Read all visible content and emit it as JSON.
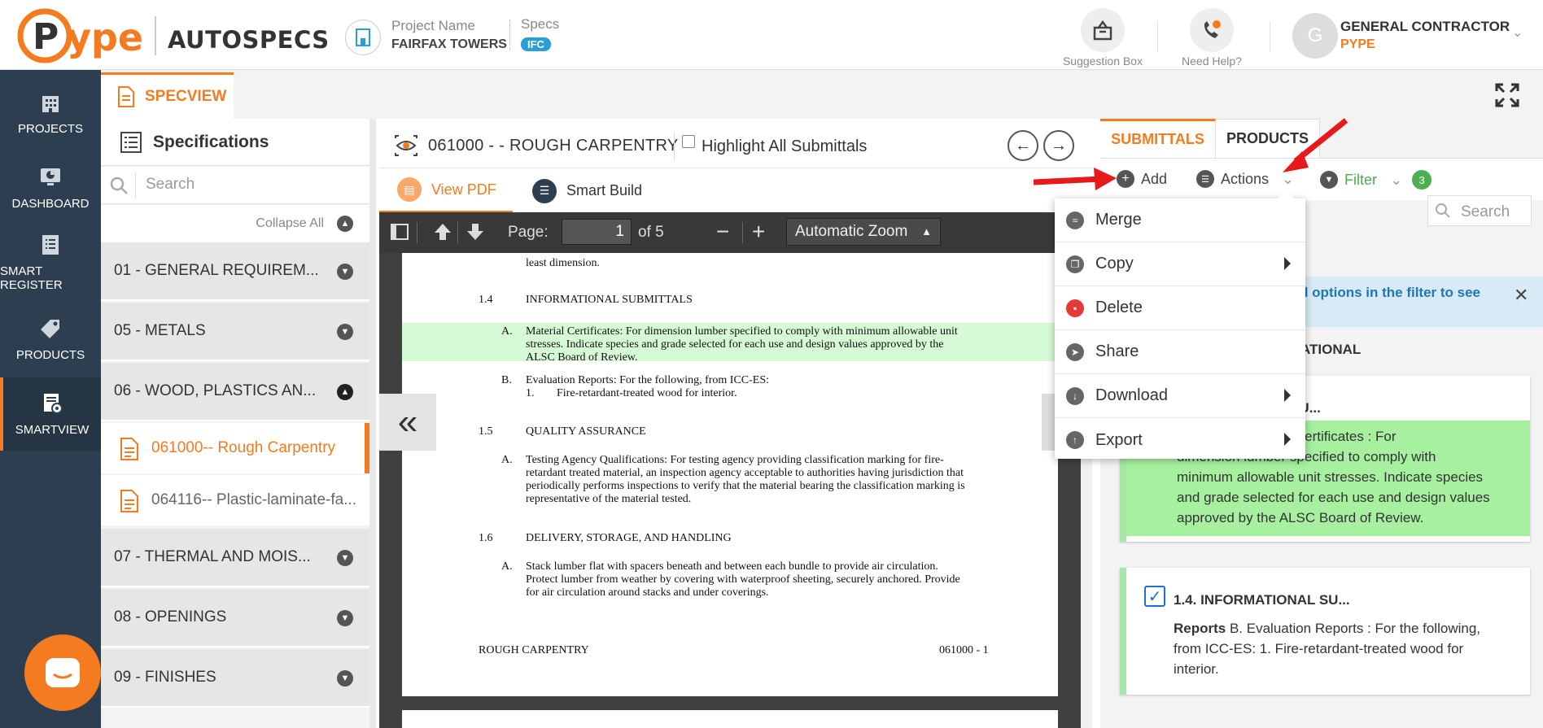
{
  "app": {
    "logo_text": "Pype",
    "product": "AUTOSPECS",
    "accent_color": "#f47b20",
    "nav_bg": "#2d3e50"
  },
  "header": {
    "project_label": "Project Name",
    "project_value": "FAIRFAX TOWERS",
    "specs_label": "Specs",
    "specs_badge": "IFC",
    "suggestion_label": "Suggestion Box",
    "help_label": "Need Help?",
    "avatar_initial": "G",
    "user_name": "GENERAL CONTRACTOR",
    "user_company": "PYPE"
  },
  "nav": {
    "items": [
      {
        "label": "PROJECTS",
        "icon": "building-icon"
      },
      {
        "label": "DASHBOARD",
        "icon": "monitor-chart-icon"
      },
      {
        "label": "SMART REGISTER",
        "icon": "list-doc-icon"
      },
      {
        "label": "PRODUCTS",
        "icon": "tag-icon"
      },
      {
        "label": "SMARTVIEW",
        "icon": "doc-view-icon"
      }
    ]
  },
  "tabbar": {
    "tab_label": "SPECVIEW"
  },
  "specs": {
    "title": "Specifications",
    "search_placeholder": "Search",
    "collapse_all": "Collapse All",
    "divisions": [
      "01 - GENERAL REQUIREM...",
      "05 - METALS",
      "06 - WOOD, PLASTICS AN...",
      "07 - THERMAL AND MOIS...",
      "08 - OPENINGS",
      "09 - FINISHES"
    ],
    "sections": [
      "061000-- Rough Carpentry",
      "064116-- Plastic-laminate-fa..."
    ]
  },
  "doc": {
    "title": "061000 - - ROUGH CARPENTRY",
    "highlight_label": "Highlight All Submittals",
    "tab_view_pdf": "View PDF",
    "tab_smart_build": "Smart Build"
  },
  "pdf": {
    "page_label": "Page:",
    "page_value": "1",
    "page_of": "of 5",
    "zoom": "Automatic Zoom",
    "lines": {
      "l0": "least dimension.",
      "n14": "1.4",
      "h14": "INFORMATIONAL SUBMITTALS",
      "a1": "A.",
      "a1t1": "Material Certificates:  For dimension lumber specified to comply with minimum allowable unit",
      "a1t2": "stresses.  Indicate species and grade selected for each use and design values approved by the",
      "a1t3": "ALSC Board of Review.",
      "b1": "B.",
      "b1t1": "Evaluation Reports:  For the following, from ICC-ES:",
      "b1n": "1.",
      "b1t2": "Fire-retardant-treated wood for interior.",
      "n15": "1.5",
      "h15": "QUALITY ASSURANCE",
      "a2": "A.",
      "a2t1": "Testing Agency Qualifications:  For testing agency providing classification marking for fire-",
      "a2t2": "retardant treated material, an inspection agency acceptable to authorities having jurisdiction that",
      "a2t3": "periodically performs inspections to verify that the material bearing the classification marking is",
      "a2t4": "representative of the material tested.",
      "n16": "1.6",
      "h16": "DELIVERY, STORAGE, AND HANDLING",
      "a3": "A.",
      "a3t1": "Stack lumber flat with spacers beneath and between each bundle to provide air circulation.",
      "a3t2": "Protect lumber from weather by covering with waterproof sheeting, securely anchored.  Provide",
      "a3t3": "for air circulation around stacks and under coverings.",
      "footer_left": "ROUGH CARPENTRY",
      "footer_right": "061000 - 1"
    }
  },
  "right": {
    "tab_submittals": "SUBMITTALS",
    "tab_products": "PRODUCTS",
    "add": "Add",
    "actions": "Actions",
    "filter": "Filter",
    "filter_count": "3",
    "search_placeholder": "Search",
    "info_text": "ll options in the filter to see",
    "section_title": "ATIONAL",
    "card1_title": "AL SU...",
    "card1_body": [
      "erial Certificates : For",
      "dimension lumber specified to comply with",
      "minimum allowable unit stresses. Indicate species",
      "and grade selected for each use and design values",
      "approved by the ALSC Board of Review."
    ],
    "card2_title": "1.4. INFORMATIONAL SU...",
    "card2_body_bold": "Reports",
    "card2_body": [
      " B. Evaluation Reports : For the following,",
      "from ICC-ES: 1. Fire-retardant-treated wood for",
      "interior."
    ]
  },
  "menu": {
    "items": [
      {
        "label": "Merge",
        "icon": "merge-icon",
        "color": "#666",
        "submenu": false
      },
      {
        "label": "Copy",
        "icon": "copy-icon",
        "color": "#666",
        "submenu": true
      },
      {
        "label": "Delete",
        "icon": "trash-icon",
        "color": "#e53935",
        "submenu": false
      },
      {
        "label": "Share",
        "icon": "share-icon",
        "color": "#666",
        "submenu": false
      },
      {
        "label": "Download",
        "icon": "cloud-download-icon",
        "color": "#666",
        "submenu": true
      },
      {
        "label": "Export",
        "icon": "cloud-upload-icon",
        "color": "#666",
        "submenu": true
      }
    ]
  }
}
